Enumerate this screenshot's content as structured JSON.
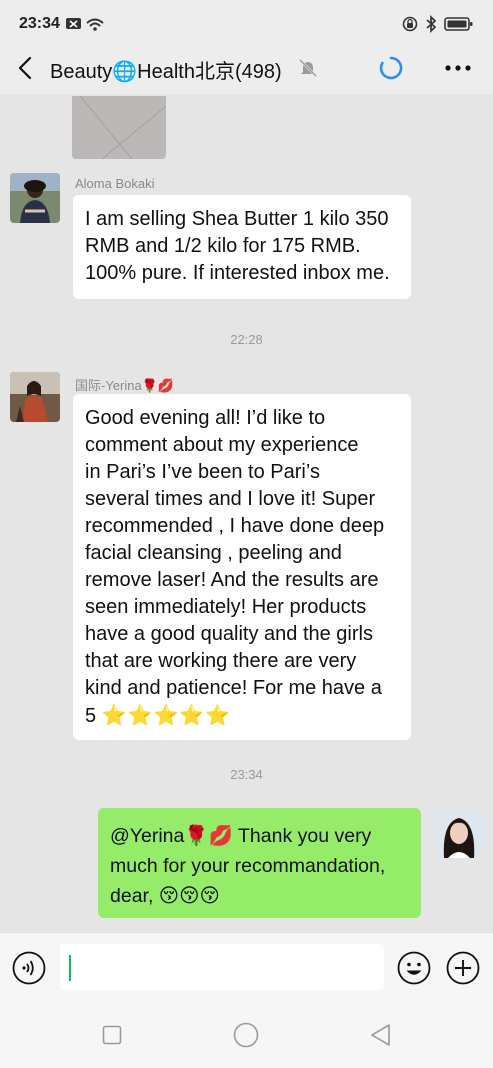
{
  "status_bar": {
    "time": "23:34"
  },
  "header": {
    "title": "Beauty🌐Health北京(498)"
  },
  "messages": [
    {
      "sender": "Aloma Bokaki",
      "text": "I am selling Shea Butter 1 kilo 350 RMB and 1/2 kilo for 175 RMB. 100% pure.  If interested inbox me."
    },
    {
      "timestamp": "22:28"
    },
    {
      "sender": "国际-Yerina🌹💋",
      "text_lines": [
        "Good evening all! I’d like to",
        "comment about my experience",
        "in Pari’s I’ve been to Pari’s",
        "several times and I love it! Super",
        "recommended , I have done deep",
        "facial cleansing , peeling and",
        "remove laser! And the results are",
        "seen immediately! Her products",
        "have a good quality and the girls",
        "that are  working there are very",
        "kind and patience! For me have a"
      ],
      "rating_prefix": "5",
      "rating_stars": "⭐⭐⭐⭐⭐"
    },
    {
      "timestamp": "23:34"
    },
    {
      "text_lines": [
        "@Yerina🌹💋 Thank you very",
        "much for your recommandation,",
        "dear, 😚😚😚"
      ]
    }
  ],
  "input": {
    "value": ""
  }
}
